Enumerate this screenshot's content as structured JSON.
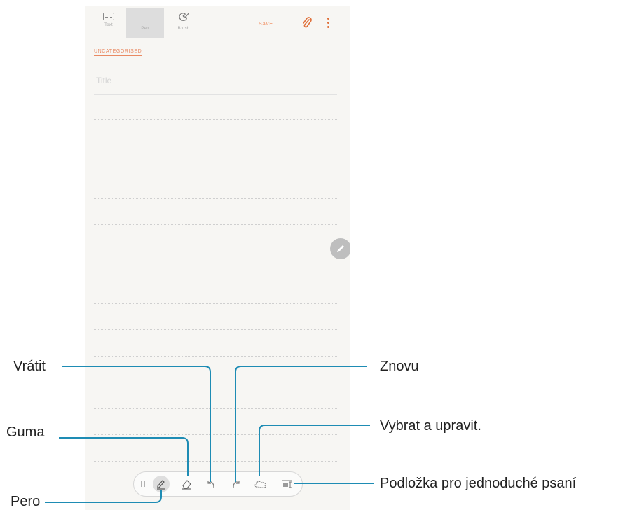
{
  "toolbar": {
    "tabs": [
      {
        "label": "Text",
        "icon": "keyboard-icon"
      },
      {
        "label": "Pen",
        "icon": "pen-icon",
        "selected": true
      },
      {
        "label": "Brush",
        "icon": "palette-icon"
      }
    ],
    "save_label": "SAVE",
    "attach_icon": "paperclip-icon",
    "more_icon": "more-vertical-icon",
    "accent_color": "#e0703a"
  },
  "note": {
    "category_label": "UNCATEGORISED",
    "title_placeholder": "Title"
  },
  "pen_toolbar": {
    "tools": [
      "grip-handle-icon",
      "pen-icon",
      "eraser-icon",
      "undo-icon",
      "redo-icon",
      "lasso-select-icon",
      "easy-writing-pad-icon"
    ],
    "selected": "pen-icon"
  },
  "callouts": {
    "undo": "Vrátit",
    "eraser": "Guma",
    "pen": "Pero",
    "redo": "Znovu",
    "select": "Vybrat a upravit.",
    "pad": "Podložka pro jednoduché psaní",
    "line_color": "#1e8cb4"
  }
}
